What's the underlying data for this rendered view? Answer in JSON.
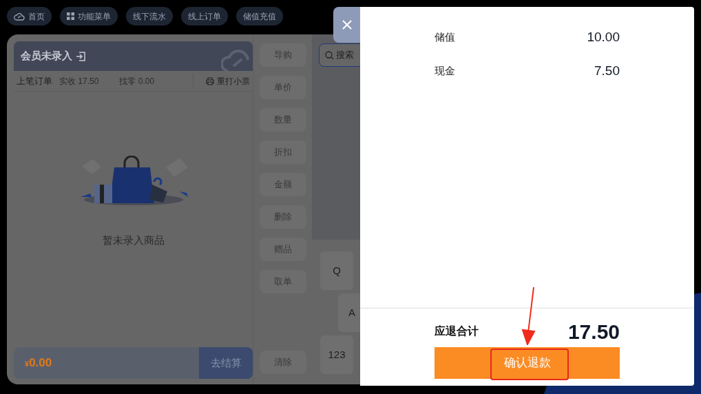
{
  "nav": [
    {
      "label": "首页",
      "kind": "cloud"
    },
    {
      "label": "功能菜单",
      "kind": "grid"
    },
    {
      "label": "线下流水",
      "kind": "plain"
    },
    {
      "label": "线上订单",
      "kind": "plain"
    },
    {
      "label": "储值充值",
      "kind": "plain"
    }
  ],
  "member": {
    "title": "会员未录入"
  },
  "last_order": {
    "label": "上笔订单",
    "received": "实收 17.50",
    "change": "找零 0.00",
    "reprint": "重打小票"
  },
  "cart": {
    "empty_text": "暂未录入商品",
    "currency": "¥",
    "total": "0.00",
    "checkout": "去结算"
  },
  "side_buttons": [
    "导购",
    "单价",
    "数量",
    "折扣",
    "金额",
    "删除",
    "赠品",
    "取单"
  ],
  "clear_button": "清除",
  "search": {
    "placeholder": "搜索"
  },
  "keyboard": [
    [
      "Q"
    ],
    [
      "A"
    ],
    [
      "123"
    ]
  ],
  "refund_drawer": {
    "rows": [
      {
        "label": "储值",
        "amount": "10.00"
      },
      {
        "label": "现金",
        "amount": "7.50"
      }
    ],
    "total_label": "应退合计",
    "total": "17.50",
    "confirm": "确认退款"
  }
}
